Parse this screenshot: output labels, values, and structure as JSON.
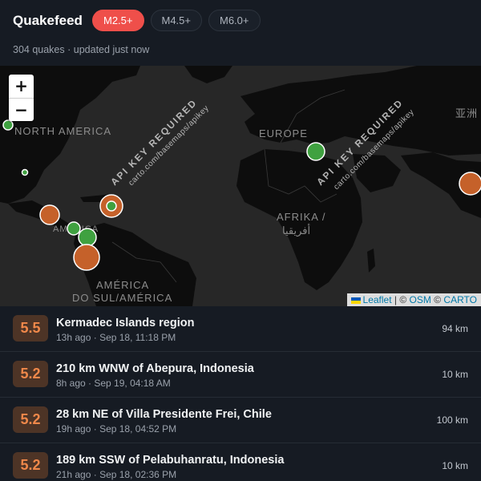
{
  "app": {
    "title": "Quakefeed"
  },
  "filters": [
    {
      "label": "M2.5+",
      "active": true
    },
    {
      "label": "M4.5+",
      "active": false
    },
    {
      "label": "M6.0+",
      "active": false
    }
  ],
  "status": {
    "count": "304 quakes",
    "separator": "·",
    "updated": "updated just now"
  },
  "map": {
    "zoom_in": "+",
    "zoom_out": "−",
    "watermark_title": "API KEY REQUIRED",
    "watermark_url": "carto.com/basemaps/apikey",
    "labels": {
      "north_america": "NORTH AMERICA",
      "europe": "EUROPE",
      "afrika": "AFRIKA /",
      "afrika_ar": "أفريقيا",
      "america_sul_1": "AMÉRICA",
      "america_sul_2": "DO SUL/AMÉRICA",
      "asia": "亚洲",
      "america_central": "AMÉRICA"
    },
    "attribution": {
      "leaflet": "Leaflet",
      "sep1": "| ©",
      "osm": "OSM",
      "sep2": "©",
      "carto": "CARTO"
    },
    "colors": {
      "strong": "#c5612a",
      "light": "#3fa140"
    }
  },
  "quakes": [
    {
      "mag": "5.5",
      "place": "Kermadec Islands region",
      "ago": "13h ago",
      "time": "Sep 18, 11:18 PM",
      "depth": "94 km"
    },
    {
      "mag": "5.2",
      "place": "210 km WNW of Abepura, Indonesia",
      "ago": "8h ago",
      "time": "Sep 19, 04:18 AM",
      "depth": "10 km"
    },
    {
      "mag": "5.2",
      "place": "28 km NE of Villa Presidente Frei, Chile",
      "ago": "19h ago",
      "time": "Sep 18, 04:52 PM",
      "depth": "100 km"
    },
    {
      "mag": "5.2",
      "place": "189 km SSW of Pelabuhanratu, Indonesia",
      "ago": "21h ago",
      "time": "Sep 18, 02:36 PM",
      "depth": "10 km"
    }
  ]
}
